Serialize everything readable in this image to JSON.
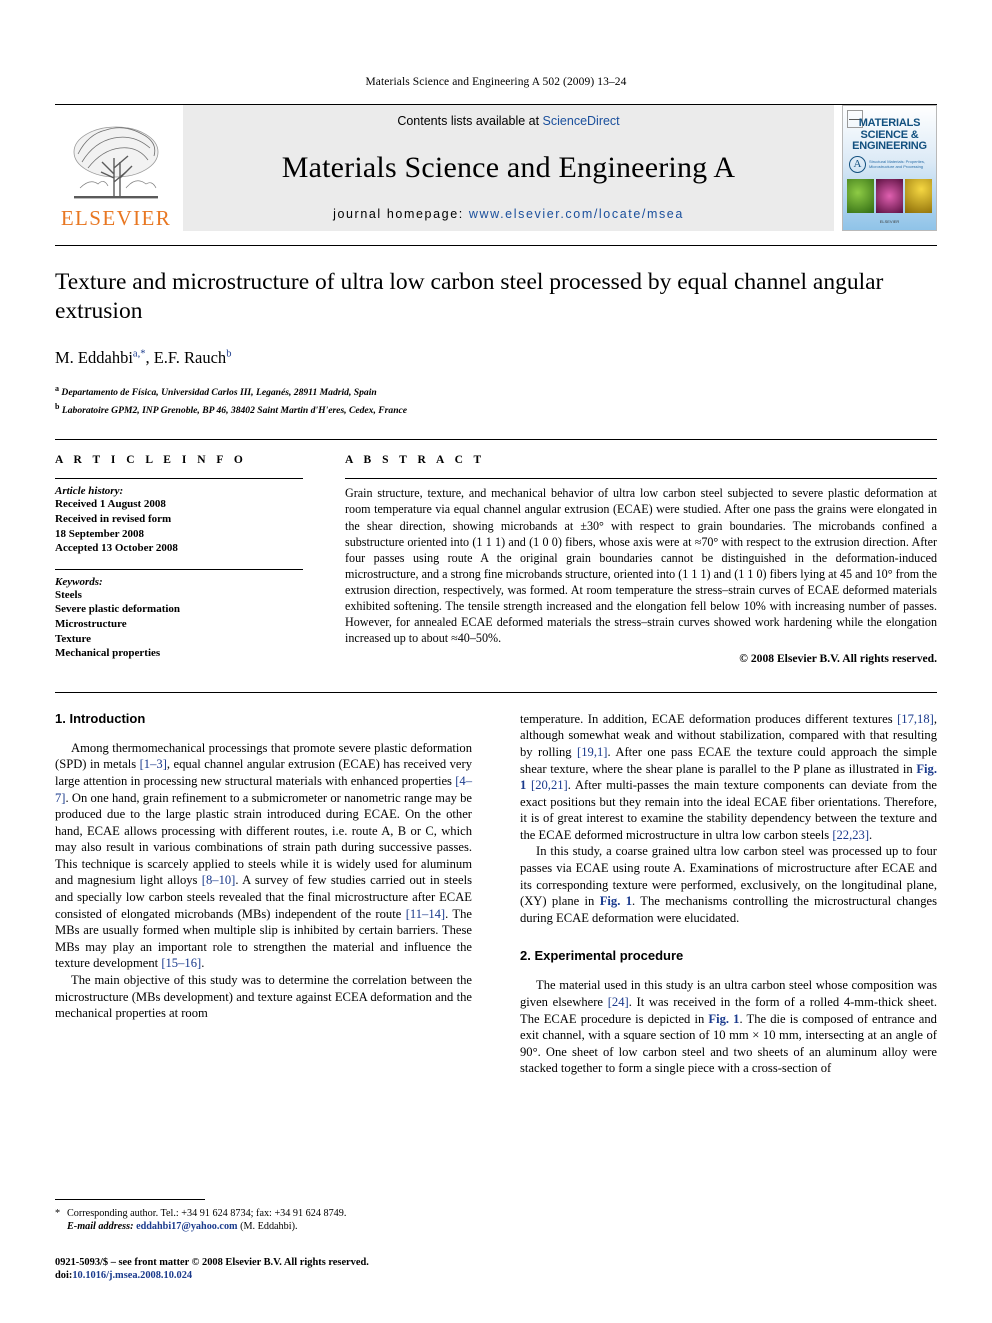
{
  "running_head": "Materials Science and Engineering A 502 (2009) 13–24",
  "masthead": {
    "publisher_name": "ELSEVIER",
    "contents_prefix": "Contents lists available at ",
    "contents_link": "ScienceDirect",
    "journal_title": "Materials Science and Engineering A",
    "homepage_label": "journal homepage:",
    "homepage_url": "www.elsevier.com/locate/msea",
    "cover": {
      "line1": "MATERIALS",
      "line2": "SCIENCE &",
      "line3": "ENGINEERING",
      "badge": "A",
      "subtitle": "Structural Materials: Properties, Microstructure and Processing",
      "footer": "ELSEVIER"
    }
  },
  "article": {
    "title": "Texture and microstructure of ultra low carbon steel processed by equal channel angular extrusion",
    "authors": "M. Eddahbi",
    "author1_sup": "a,*",
    "author2": "E.F. Rauch",
    "author2_sup": "b",
    "affiliation_a_sup": "a",
    "affiliation_a": "Departamento de Física, Universidad Carlos III, Leganés, 28911 Madrid, Spain",
    "affiliation_b_sup": "b",
    "affiliation_b": "Laboratoire GPM2, INP Grenoble, BP 46, 38402 Saint Martin d'H'eres, Cedex, France"
  },
  "article_info": {
    "heading": "A R T I C L E   I N F O",
    "history_label": "Article history:",
    "history_lines": [
      "Received 1 August 2008",
      "Received in revised form",
      "18 September 2008",
      "Accepted 13 October 2008"
    ],
    "keywords_label": "Keywords:",
    "keywords": [
      "Steels",
      "Severe plastic deformation",
      "Microstructure",
      "Texture",
      "Mechanical properties"
    ]
  },
  "abstract": {
    "heading": "A B S T R A C T",
    "text": "Grain structure, texture, and mechanical behavior of ultra low carbon steel subjected to severe plastic deformation at room temperature via equal channel angular extrusion (ECAE) were studied. After one pass the grains were elongated in the shear direction, showing microbands at ±30° with respect to grain boundaries. The microbands confined a substructure oriented into (1 1 1) and (1 0 0) fibers, whose axis were at ≈70° with respect to the extrusion direction. After four passes using route A the original grain boundaries cannot be distinguished in the deformation-induced microstructure, and a strong fine microbands structure, oriented into (1 1 1) and (1 1 0) fibers lying at 45 and 10° from the extrusion direction, respectively, was formed. At room temperature the stress–strain curves of ECAE deformed materials exhibited softening. The tensile strength increased and the elongation fell below 10% with increasing number of passes. However, for annealed ECAE deformed materials the stress–strain curves showed work hardening while the elongation increased up to about ≈40–50%.",
    "copyright": "© 2008 Elsevier B.V. All rights reserved."
  },
  "sections": {
    "intro_heading": "1.  Introduction",
    "intro_p1": "Among thermomechanical processings that promote severe plastic deformation (SPD) in metals [1–3], equal channel angular extrusion (ECAE) has received very large attention in processing new structural materials with enhanced properties [4–7]. On one hand, grain refinement to a submicrometer or nanometric range may be produced due to the large plastic strain introduced during ECAE. On the other hand, ECAE allows processing with different routes, i.e. route A, B or C, which may also result in various combinations of strain path during successive passes. This technique is scarcely applied to steels while it is widely used for aluminum and magnesium light alloys [8–10]. A survey of few studies carried out in steels and specially low carbon steels revealed that the final microstructure after ECAE consisted of elongated microbands (MBs) independent of the route [11–14]. The MBs are usually formed when multiple slip is inhibited by certain barriers. These MBs may play an important role to strengthen the material and influence the texture development [15–16].",
    "intro_p2": "The main objective of this study was to determine the correlation between the microstructure (MBs development) and texture against ECEA deformation and the mechanical properties at room temperature. In addition, ECAE deformation produces different textures [17,18], although somewhat weak and without stabilization, compared with that resulting by rolling [19,1]. After one pass ECAE the texture could approach the simple shear texture, where the shear plane is parallel to the P plane as illustrated in Fig. 1 [20,21]. After multi-passes the main texture components can deviate from the exact positions but they remain into the ideal ECAE fiber orientations. Therefore, it is of great interest to examine the stability dependency between the texture and the ECAE deformed microstructure in ultra low carbon steels [22,23].",
    "intro_p3": "In this study, a coarse grained ultra low carbon steel was processed up to four passes via ECAE using route A. Examinations of microstructure after ECAE and its corresponding texture were performed, exclusively, on the longitudinal plane, (XY) plane in Fig. 1. The mechanisms controlling the microstructural changes during ECAE deformation were elucidated.",
    "exp_heading": "2.  Experimental procedure",
    "exp_p1": "The material used in this study is an ultra carbon steel whose composition was given elsewhere [24]. It was received in the form of a rolled 4-mm-thick sheet. The ECAE procedure is depicted in Fig. 1. The die is composed of entrance and exit channel, with a square section of 10 mm × 10 mm, intersecting at an angle of 90°. One sheet of low carbon steel and two sheets of an aluminum alloy were stacked together to form a single piece with a cross-section of"
  },
  "footnotes": {
    "corresponding": "Corresponding author. Tel.: +34 91 624 8734; fax: +34 91 624 8749.",
    "email_label": "E-mail address:",
    "email": "eddahbi17@yahoo.com",
    "email_owner": "(M. Eddahbi).",
    "issn_line": "0921-5093/$ – see front matter © 2008 Elsevier B.V. All rights reserved.",
    "doi_label": "doi:",
    "doi": "10.1016/j.msea.2008.10.024"
  },
  "colors": {
    "link": "#1a3a8c",
    "elsevier_orange": "#E87722",
    "band_gray": "#ebebeb"
  }
}
